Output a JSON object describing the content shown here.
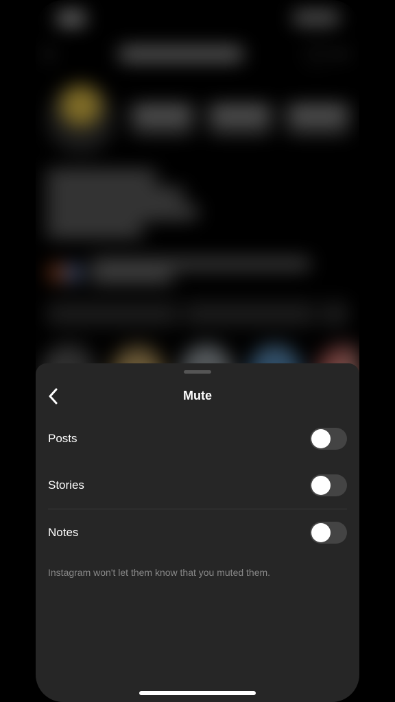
{
  "sheet": {
    "title": "Mute",
    "options": [
      {
        "label": "Posts",
        "enabled": false
      },
      {
        "label": "Stories",
        "enabled": false
      },
      {
        "label": "Notes",
        "enabled": false
      }
    ],
    "footer_text": "Instagram won't let them know that you muted them."
  }
}
